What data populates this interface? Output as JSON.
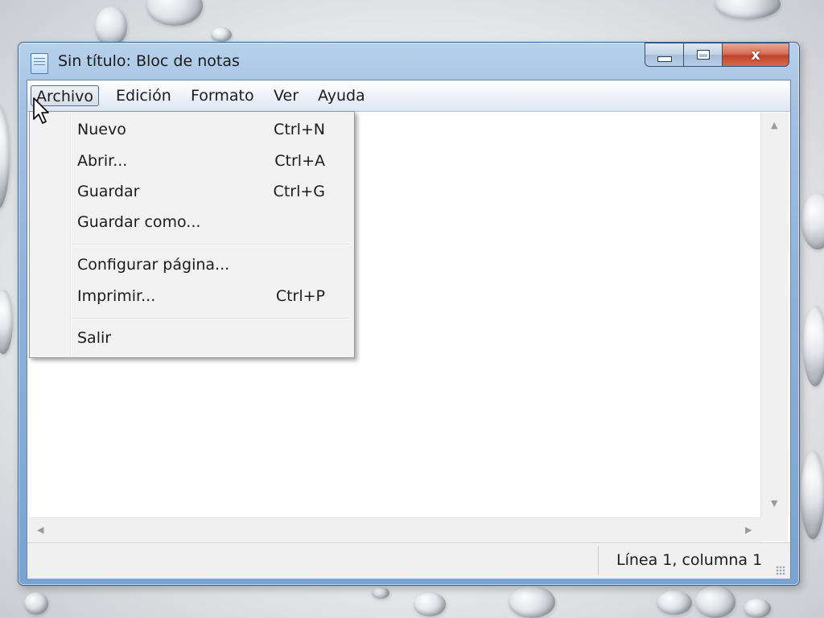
{
  "window": {
    "title": "Sin título: Bloc de notas",
    "controls": {
      "minimize": "minimize",
      "maximize": "maximize",
      "close": "x"
    }
  },
  "menubar": {
    "items": [
      "Archivo",
      "Edición",
      "Formato",
      "Ver",
      "Ayuda"
    ],
    "active": "Archivo"
  },
  "file_menu": {
    "items": [
      {
        "label": "Nuevo",
        "shortcut": "Ctrl+N"
      },
      {
        "label": "Abrir...",
        "shortcut": "Ctrl+A"
      },
      {
        "label": "Guardar",
        "shortcut": "Ctrl+G"
      },
      {
        "label": "Guardar como...",
        "shortcut": ""
      },
      {
        "label": "Configurar página...",
        "shortcut": ""
      },
      {
        "label": "Imprimir...",
        "shortcut": "Ctrl+P"
      },
      {
        "label": "Salir",
        "shortcut": ""
      }
    ]
  },
  "statusbar": {
    "position": "Línea 1, columna 1"
  },
  "colors": {
    "frame": "#8fb2da",
    "close_button": "#c0432a",
    "menu_background": "#f2f2f2"
  }
}
